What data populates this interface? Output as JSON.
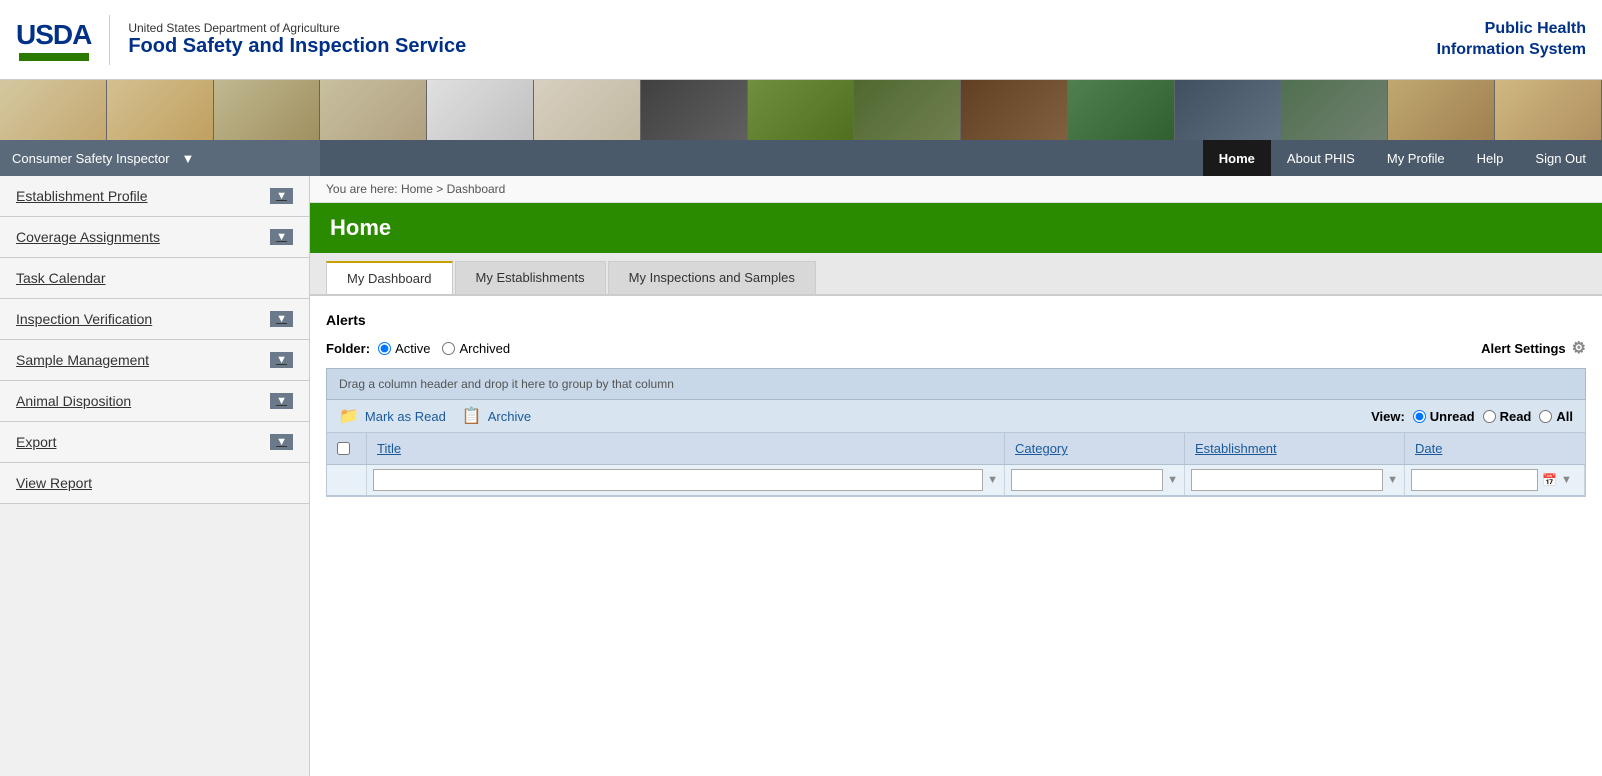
{
  "header": {
    "usda_acronym": "USDA",
    "dept_name": "United States Department of Agriculture",
    "fsis_name": "Food Safety and Inspection Service",
    "system_name": "Public Health\nInformation System",
    "phis_line1": "Public Health",
    "phis_line2": "Information System"
  },
  "nav": {
    "role": "Consumer Safety Inspector",
    "links": [
      {
        "label": "Home",
        "active": true
      },
      {
        "label": "About PHIS",
        "active": false
      },
      {
        "label": "My Profile",
        "active": false
      },
      {
        "label": "Help",
        "active": false
      },
      {
        "label": "Sign Out",
        "active": false
      }
    ]
  },
  "breadcrumb": {
    "text": "You are here: Home > Dashboard",
    "home": "Home",
    "current": "Dashboard"
  },
  "sidebar": {
    "items": [
      {
        "label": "Establishment Profile",
        "has_dropdown": true
      },
      {
        "label": "Coverage Assignments",
        "has_dropdown": true
      },
      {
        "label": "Task Calendar",
        "has_dropdown": false
      },
      {
        "label": "Inspection Verification",
        "has_dropdown": true
      },
      {
        "label": "Sample Management",
        "has_dropdown": true
      },
      {
        "label": "Animal Disposition",
        "has_dropdown": true
      },
      {
        "label": "Export",
        "has_dropdown": true
      },
      {
        "label": "View Report",
        "has_dropdown": false
      }
    ]
  },
  "page": {
    "title": "Home"
  },
  "tabs": [
    {
      "label": "My Dashboard",
      "active": true
    },
    {
      "label": "My Establishments",
      "active": false
    },
    {
      "label": "My Inspections and Samples",
      "active": false
    }
  ],
  "alerts": {
    "section_title": "Alerts",
    "folder_label": "Folder:",
    "active_label": "Active",
    "archived_label": "Archived",
    "active_checked": true,
    "archived_checked": false,
    "alert_settings_label": "Alert Settings",
    "drag_header_text": "Drag a column header and drop it here to group by that column",
    "toolbar": {
      "mark_as_read_label": "Mark as Read",
      "archive_label": "Archive",
      "view_label": "View:",
      "unread_label": "Unread",
      "read_label": "Read",
      "all_label": "All"
    },
    "table": {
      "columns": [
        {
          "key": "title",
          "label": "Title",
          "sortable": true
        },
        {
          "key": "category",
          "label": "Category",
          "sortable": true
        },
        {
          "key": "establishment",
          "label": "Establishment",
          "sortable": true
        },
        {
          "key": "date",
          "label": "Date",
          "sortable": true
        }
      ],
      "rows": []
    }
  }
}
